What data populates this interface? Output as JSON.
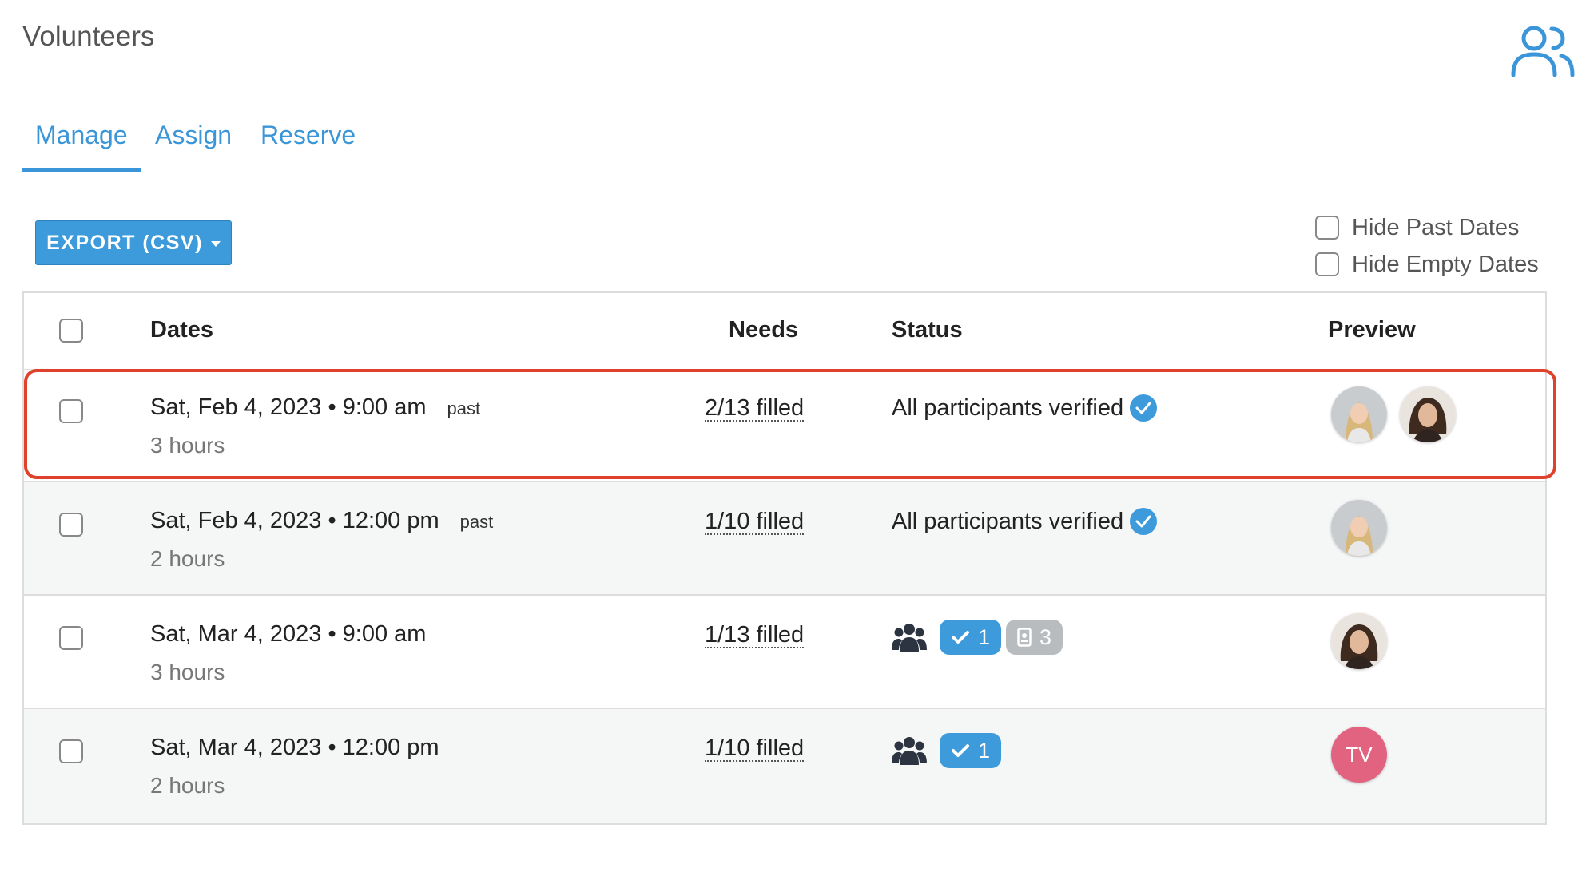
{
  "page": {
    "title": "Volunteers",
    "header_icon": "users-icon"
  },
  "tabs": [
    {
      "label": "Manage",
      "active": true
    },
    {
      "label": "Assign",
      "active": false
    },
    {
      "label": "Reserve",
      "active": false
    }
  ],
  "toolbar": {
    "export_label": "EXPORT (CSV)"
  },
  "filters": [
    {
      "label": "Hide Past Dates",
      "checked": false
    },
    {
      "label": "Hide Empty Dates",
      "checked": false
    }
  ],
  "table": {
    "columns": [
      "Dates",
      "Needs",
      "Status",
      "Preview"
    ],
    "rows": [
      {
        "date": "Sat, Feb 4, 2023 • 9:00 am",
        "tag": "past",
        "duration": "3 hours",
        "needs": "2/13 filled",
        "status_text": "All participants verified",
        "highlighted": true
      },
      {
        "date": "Sat, Feb 4, 2023 • 12:00 pm",
        "tag": "past",
        "duration": "2 hours",
        "needs": "1/10 filled",
        "status_text": "All participants verified",
        "highlighted": false
      },
      {
        "date": "Sat, Mar 4, 2023 • 9:00 am",
        "tag": "",
        "duration": "3 hours",
        "needs": "1/13 filled",
        "verified_count": "1",
        "pending_count": "3",
        "highlighted": false
      },
      {
        "date": "Sat, Mar 4, 2023 • 12:00 pm",
        "tag": "",
        "duration": "2 hours",
        "needs": "1/10 filled",
        "verified_count": "1",
        "avatar_initials": "TV",
        "highlighted": false
      }
    ]
  },
  "colors": {
    "accent": "#3a96d8",
    "highlight": "#e0412c",
    "initials_avatar": "#e2637f"
  }
}
